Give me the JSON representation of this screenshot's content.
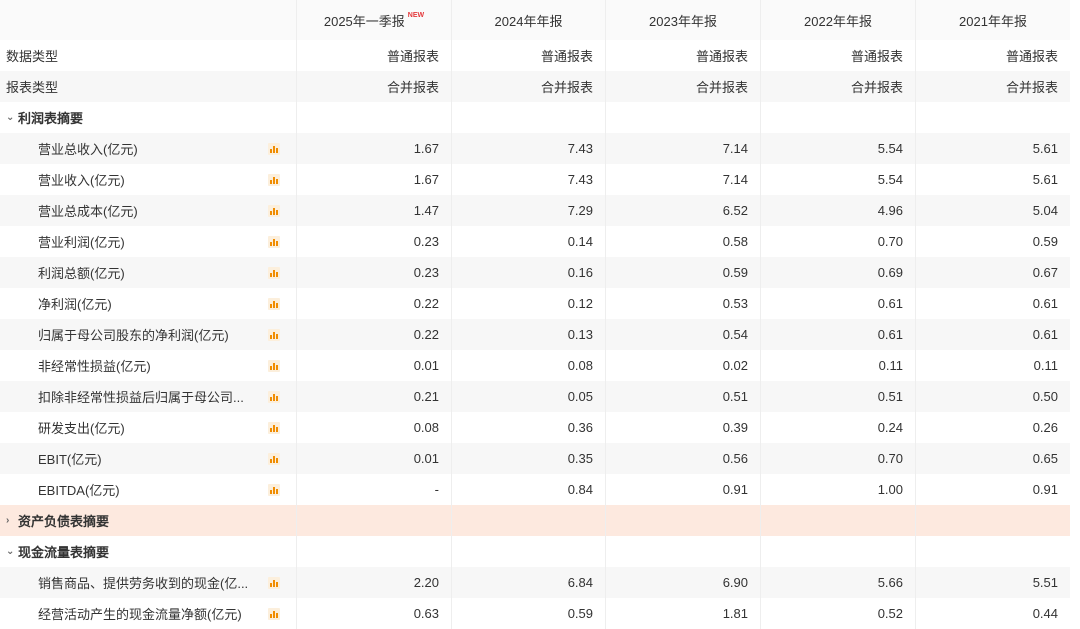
{
  "columns": [
    "2025年一季报",
    "2024年年报",
    "2023年年报",
    "2022年年报",
    "2021年年报"
  ],
  "new_badge": "NEW",
  "meta_rows": [
    {
      "label": "数据类型",
      "values": [
        "普通报表",
        "普通报表",
        "普通报表",
        "普通报表",
        "普通报表"
      ]
    },
    {
      "label": "报表类型",
      "values": [
        "合并报表",
        "合并报表",
        "合并报表",
        "合并报表",
        "合并报表"
      ]
    }
  ],
  "sections": [
    {
      "title": "利润表摘要",
      "expanded": true,
      "rows": [
        {
          "label": "营业总收入(亿元)",
          "values": [
            "1.67",
            "7.43",
            "7.14",
            "5.54",
            "5.61"
          ]
        },
        {
          "label": "营业收入(亿元)",
          "values": [
            "1.67",
            "7.43",
            "7.14",
            "5.54",
            "5.61"
          ]
        },
        {
          "label": "营业总成本(亿元)",
          "values": [
            "1.47",
            "7.29",
            "6.52",
            "4.96",
            "5.04"
          ]
        },
        {
          "label": "营业利润(亿元)",
          "values": [
            "0.23",
            "0.14",
            "0.58",
            "0.70",
            "0.59"
          ]
        },
        {
          "label": "利润总额(亿元)",
          "values": [
            "0.23",
            "0.16",
            "0.59",
            "0.69",
            "0.67"
          ]
        },
        {
          "label": "净利润(亿元)",
          "values": [
            "0.22",
            "0.12",
            "0.53",
            "0.61",
            "0.61"
          ]
        },
        {
          "label": "归属于母公司股东的净利润(亿元)",
          "values": [
            "0.22",
            "0.13",
            "0.54",
            "0.61",
            "0.61"
          ]
        },
        {
          "label": "非经常性损益(亿元)",
          "values": [
            "0.01",
            "0.08",
            "0.02",
            "0.11",
            "0.11"
          ]
        },
        {
          "label": "扣除非经常性损益后归属于母公司...",
          "values": [
            "0.21",
            "0.05",
            "0.51",
            "0.51",
            "0.50"
          ]
        },
        {
          "label": "研发支出(亿元)",
          "values": [
            "0.08",
            "0.36",
            "0.39",
            "0.24",
            "0.26"
          ]
        },
        {
          "label": "EBIT(亿元)",
          "values": [
            "0.01",
            "0.35",
            "0.56",
            "0.70",
            "0.65"
          ]
        },
        {
          "label": "EBITDA(亿元)",
          "values": [
            "-",
            "0.84",
            "0.91",
            "1.00",
            "0.91"
          ]
        }
      ]
    },
    {
      "title": "资产负债表摘要",
      "expanded": false,
      "rows": []
    },
    {
      "title": "现金流量表摘要",
      "expanded": true,
      "rows": [
        {
          "label": "销售商品、提供劳务收到的现金(亿...",
          "values": [
            "2.20",
            "6.84",
            "6.90",
            "5.66",
            "5.51"
          ]
        },
        {
          "label": "经营活动产生的现金流量净额(亿元)",
          "values": [
            "0.63",
            "0.59",
            "1.81",
            "0.52",
            "0.44"
          ]
        }
      ]
    }
  ]
}
